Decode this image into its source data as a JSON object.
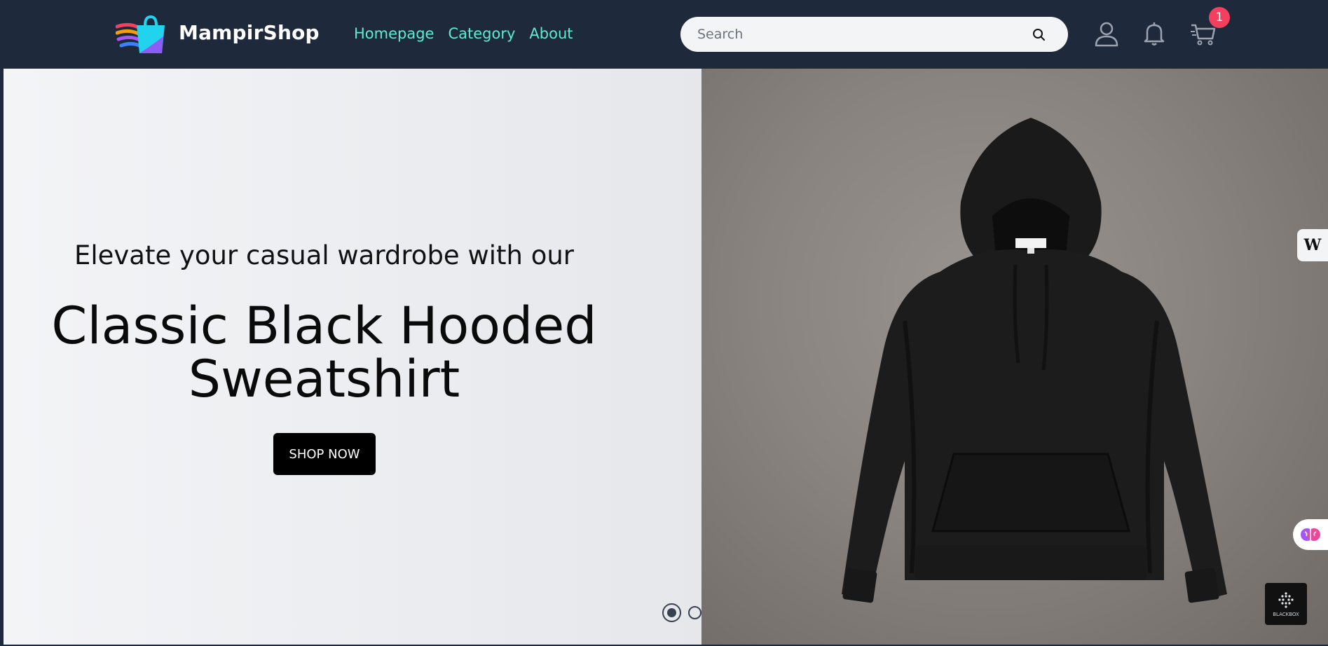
{
  "header": {
    "brand_name": "MampirShop",
    "logo_icon": "shopping-bag-logo",
    "nav": [
      {
        "label": "Homepage"
      },
      {
        "label": "Category"
      },
      {
        "label": "About"
      }
    ],
    "search": {
      "placeholder": "Search",
      "value": "",
      "icon": "search-icon"
    },
    "icons": [
      "user-icon",
      "bell-icon",
      "cart-icon"
    ],
    "cart_count": "1"
  },
  "hero": {
    "tagline": "Elevate your casual wardrobe with our",
    "title_line1": "Classic Black Hooded",
    "title_line2": "Sweatshirt",
    "cta_label": "SHOP NOW",
    "slides_total": 3,
    "active_slide": 1,
    "image": "black-hoodie-photo"
  },
  "widgets": {
    "side_tab_letter": "W",
    "brain_icon": "brain-icon",
    "blackbox_label": "BLACKBOX"
  },
  "colors": {
    "header_bg": "#1e293b",
    "nav_link": "#5eead4",
    "badge": "#f43f5e",
    "cta_bg": "#000000"
  }
}
